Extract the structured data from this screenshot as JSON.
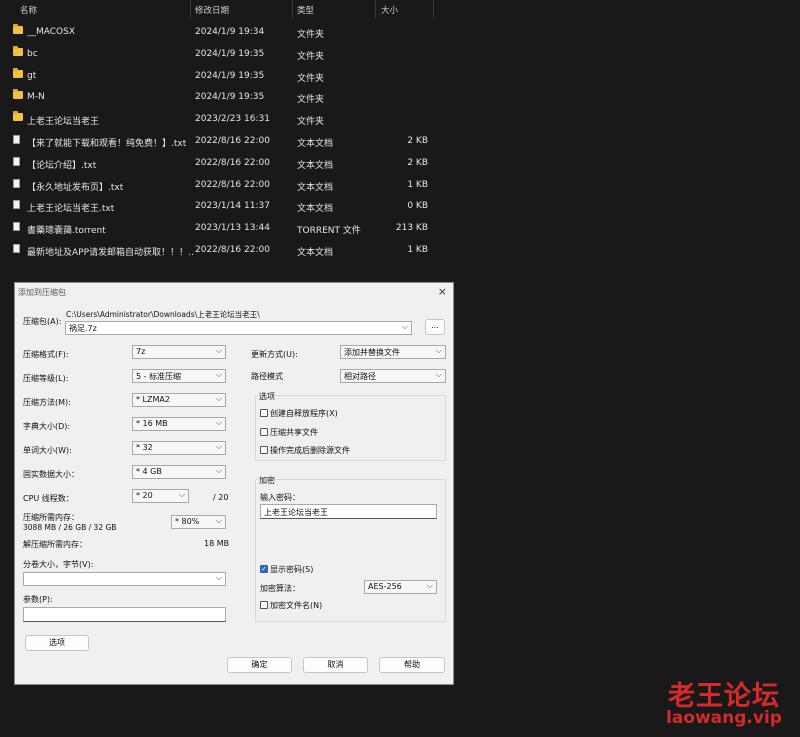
{
  "explorer": {
    "columns": [
      "名称",
      "修改日期",
      "类型",
      "大小"
    ],
    "rows": [
      {
        "name": "__MACOSX",
        "date": "2024/1/9 19:34",
        "type": "文件夹",
        "size": "",
        "icon": "folder-icon"
      },
      {
        "name": "bc",
        "date": "2024/1/9 19:35",
        "type": "文件夹",
        "size": "",
        "icon": "folder-icon"
      },
      {
        "name": "gt",
        "date": "2024/1/9 19:35",
        "type": "文件夹",
        "size": "",
        "icon": "folder-icon"
      },
      {
        "name": "M-N",
        "date": "2024/1/9 19:35",
        "type": "文件夹",
        "size": "",
        "icon": "folder-icon"
      },
      {
        "name": "上老王论坛当老王",
        "date": "2023/2/23 16:31",
        "type": "文件夹",
        "size": "",
        "icon": "folder-icon"
      },
      {
        "name": "【来了就能下载和观看！纯免费！】.txt",
        "date": "2022/8/16 22:00",
        "type": "文本文档",
        "size": "2 KB",
        "icon": "text-file-icon"
      },
      {
        "name": "【论坛介绍】.txt",
        "date": "2022/8/16 22:00",
        "type": "文本文档",
        "size": "2 KB",
        "icon": "text-file-icon"
      },
      {
        "name": "【永久地址发布页】.txt",
        "date": "2022/8/16 22:00",
        "type": "文本文档",
        "size": "1 KB",
        "icon": "text-file-icon"
      },
      {
        "name": "上老王论坛当老王.txt",
        "date": "2023/1/14 11:37",
        "type": "文本文档",
        "size": "0 KB",
        "icon": "text-file-icon"
      },
      {
        "name": "書藥璁嚢藹.torrent",
        "date": "2023/1/13 13:44",
        "type": "TORRENT 文件",
        "size": "213 KB",
        "icon": "file-icon"
      },
      {
        "name": "最新地址及APP请发邮箱自动获取！！！…",
        "date": "2022/8/16 22:00",
        "type": "文本文档",
        "size": "1 KB",
        "icon": "text-file-icon"
      }
    ]
  },
  "dialog": {
    "title": "添加到压缩包",
    "close": "×",
    "archive_label": "压缩包(A):",
    "archive_path": "C:\\Users\\Administrator\\Downloads\\上老王论坛当老王\\",
    "archive_name": "祸足.7z",
    "browse": "...",
    "format_label": "压缩格式(F):",
    "format_value": "7z",
    "level_label": "压缩等级(L):",
    "level_value": "5 - 标准压缩",
    "method_label": "压缩方法(M):",
    "method_value": "* LZMA2",
    "dict_label": "字典大小(D):",
    "dict_value": "* 16 MB",
    "word_label": "单词大小(W):",
    "word_value": "* 32",
    "solid_label": "固实数据大小：",
    "solid_value": "* 4 GB",
    "cpu_label": "CPU 线程数：",
    "cpu_value": "* 20",
    "cpu_total": "/ 20",
    "mem_label": "压缩所需内存：",
    "mem_detail": "3088 MB / 26 GB / 32 GB",
    "mem_pct": "* 80%",
    "decomp_label": "解压缩所需内存：",
    "decomp_value": "18 MB",
    "split_label": "分卷大小，字节(V):",
    "split_value": "",
    "params_label": "参数(P):",
    "params_value": "",
    "options_btn": "选项",
    "update_label": "更新方式(U):",
    "update_value": "添加并替换文件",
    "path_label": "路径模式",
    "path_value": "相对路径",
    "opt_group": "选项",
    "opt_sfx": "创建自释放程序(X)",
    "opt_shared": "压缩共享文件",
    "opt_delete": "操作完成后删除源文件",
    "enc_group": "加密",
    "pwd_label": "输入密码：",
    "pwd_value": "上老王论坛当老王",
    "show_pwd": "显示密码(S)",
    "enc_method_label": "加密算法：",
    "enc_method_value": "AES-256",
    "enc_names": "加密文件名(N)",
    "ok": "确定",
    "cancel": "取消",
    "help": "帮助"
  },
  "watermark": {
    "line1": "老王论坛",
    "line2": "laowang.vip"
  }
}
